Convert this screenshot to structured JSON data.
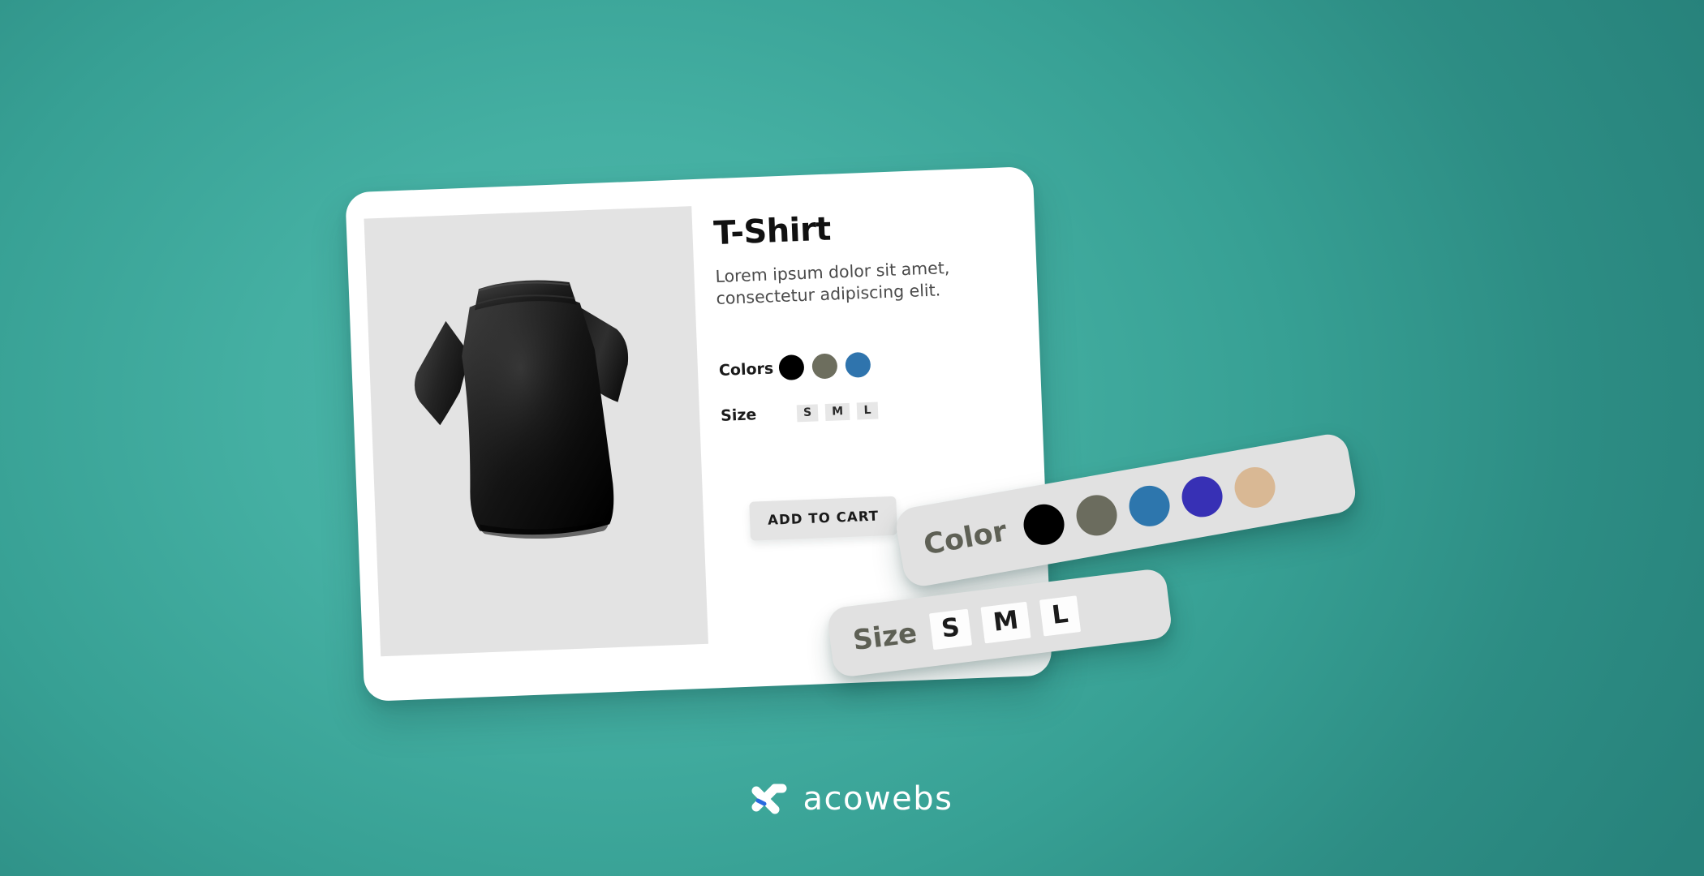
{
  "background": {
    "color_center": "#45b0a3",
    "color_edge": "#27827b"
  },
  "card": {
    "title": "T-Shirt",
    "description": "Lorem ipsum dolor sit amet, consectetur adipiscing elit.",
    "product_image_alt": "black polo t-shirt back view",
    "colors": {
      "label": "Colors",
      "swatches": [
        {
          "name": "black",
          "hex": "#000000"
        },
        {
          "name": "olive-gray",
          "hex": "#6d6e5e"
        },
        {
          "name": "steel-blue",
          "hex": "#2f74ad"
        }
      ]
    },
    "size": {
      "label": "Size",
      "options": [
        "S",
        "M",
        "L"
      ]
    },
    "add_to_cart_label": "ADD TO CART"
  },
  "color_panel": {
    "label": "Color",
    "swatches": [
      {
        "name": "black",
        "hex": "#000000"
      },
      {
        "name": "olive-gray",
        "hex": "#6b6c5e"
      },
      {
        "name": "steel-blue",
        "hex": "#2d76ad"
      },
      {
        "name": "indigo-blue",
        "hex": "#3730b5"
      },
      {
        "name": "tan",
        "hex": "#d9b894"
      }
    ]
  },
  "size_panel": {
    "label": "Size",
    "options": [
      "S",
      "M",
      "L"
    ]
  },
  "brand": {
    "name": "acowebs",
    "mark": "acowebs-x-logo-icon",
    "mark_color": "#ffffff",
    "mark_accent": "#2a6ae0"
  }
}
